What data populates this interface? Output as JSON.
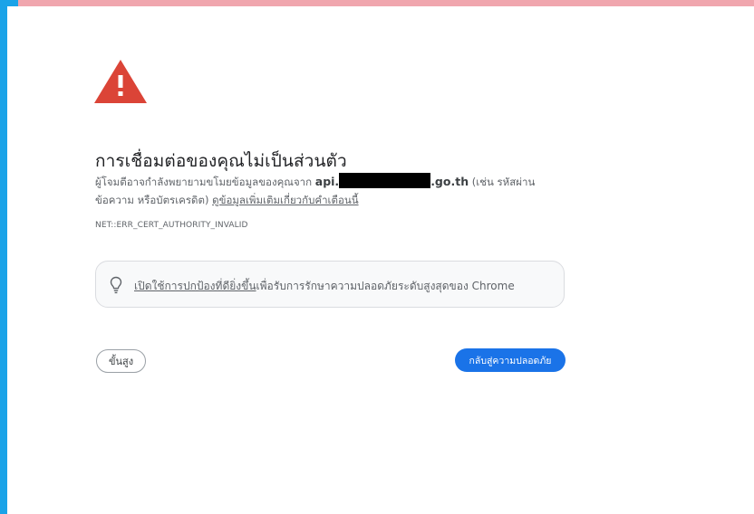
{
  "page": {
    "title": "การเชื่อมต่อของคุณไม่เป็นส่วนตัว",
    "description": {
      "prefix": "ผู้โจมตีอาจกำลังพยายามขโมยข้อมูลของคุณจาก ",
      "host_start": "api.",
      "host_end": ".go.th",
      "after_host": " (เช่น รหัสผ่าน ข้อความ หรือบัตรเครดิต) ",
      "learn_more_link": "ดูข้อมูลเพิ่มเติมเกี่ยวกับคำเตือนนี้"
    },
    "error_code": "NET::ERR_CERT_AUTHORITY_INVALID",
    "protection": {
      "link_text": "เปิดใช้การปกป้องที่ดียิ่งขึ้น",
      "text": "เพื่อรับการรักษาความปลอดภัยระดับสูงสุดของ Chrome"
    },
    "buttons": {
      "advanced": "ขั้นสูง",
      "back_to_safety": "กลับสู่ความปลอดภัย"
    }
  },
  "icons": {
    "warning": "warning-triangle-icon",
    "bulb": "lightbulb-icon"
  },
  "colors": {
    "warning_red": "#db4437",
    "primary_blue": "#1a73e8",
    "left_border": "#1aa3e8",
    "top_strip": "#f0a6ae"
  }
}
